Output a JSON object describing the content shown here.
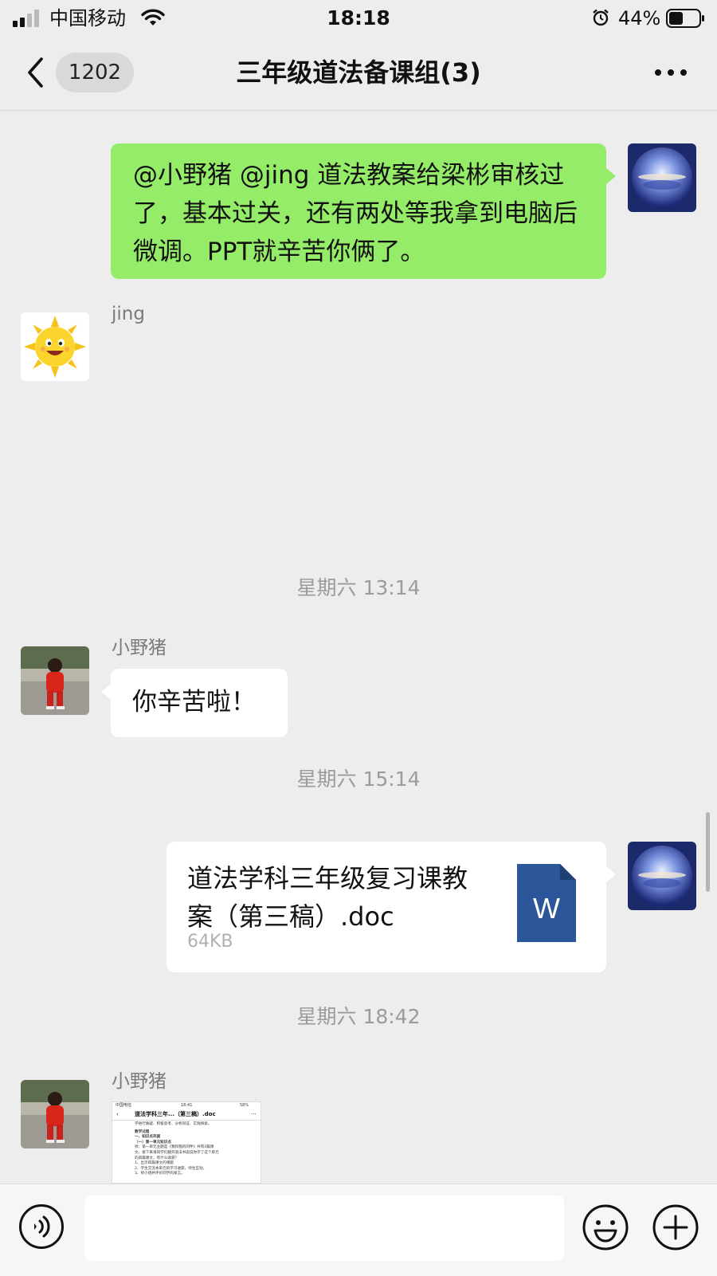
{
  "status_bar": {
    "carrier": "中国移动",
    "time": "18:18",
    "battery": "44%"
  },
  "header": {
    "unread_count": "1202",
    "title": "三年级道法备课组(3)"
  },
  "messages": [
    {
      "type": "text",
      "side": "right",
      "text": "@小野猪 @jing 道法教案给梁彬审核过了，基本过关，还有两处等我拿到电脑后微调。PPT就辛苦你俩了。"
    },
    {
      "type": "sender-only",
      "side": "left",
      "sender": "jing"
    },
    {
      "type": "timestamp",
      "text": "星期六 13:14"
    },
    {
      "type": "text",
      "side": "left",
      "sender": "小野猪",
      "text": "你辛苦啦！"
    },
    {
      "type": "timestamp",
      "text": "星期六 15:14"
    },
    {
      "type": "file",
      "side": "right",
      "file_name": "道法学科三年级复习课教案（第三稿）.doc",
      "file_size": "64KB",
      "file_icon_letter": "W"
    },
    {
      "type": "timestamp",
      "text": "星期六 18:42"
    },
    {
      "type": "image",
      "side": "left",
      "sender": "小野猪",
      "preview": {
        "carrier": "中国电信",
        "time": "18:41",
        "battery": "58%",
        "title": "道法学科三年...（第三稿）.doc",
        "lines": [
          "学进行质疑、积极思考、分析辩证、实践探索。",
          "教学过程",
          "一、知识点巩固",
          "（一）第一单元知识点",
          "师：第一单元主题是《我和我的同伴》共有4篇课",
          "文。接下来请同学们翻开道法书说说你学了这个单元",
          "的四篇课文，有什么收获？",
          "1、出示四篇课文的课题",
          "2、学生交流本单元的学习收获，师生互动。",
          "3、师小组并评价同学的发言。"
        ]
      }
    }
  ],
  "icons": {
    "back": "chevron-left-icon",
    "more": "more-dots-icon",
    "voice": "voice-icon",
    "emoji": "emoji-icon",
    "plus": "plus-icon"
  },
  "colors": {
    "background": "#ededed",
    "my_bubble": "#95ec69",
    "other_bubble": "#ffffff",
    "word_blue": "#2b579a"
  }
}
